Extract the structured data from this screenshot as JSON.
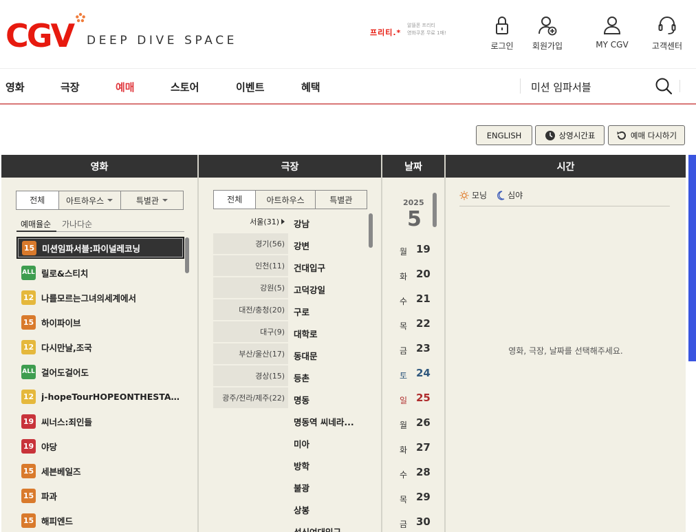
{
  "header": {
    "logo_text": "CGV",
    "tagline": "DEEP DIVE SPACE",
    "promo_brand": "프리티.*",
    "promo_line1": "알뜰폰 프리티",
    "promo_line2": "영화쿠폰 무료 1매!",
    "util": [
      {
        "label": "로그인",
        "icon": "lock-icon"
      },
      {
        "label": "회원가입",
        "icon": "user-plus-icon"
      },
      {
        "label": "MY CGV",
        "icon": "user-icon"
      },
      {
        "label": "고객센터",
        "icon": "headset-icon"
      }
    ]
  },
  "nav": {
    "items": [
      "영화",
      "극장",
      "예매",
      "스토어",
      "이벤트",
      "혜택"
    ],
    "active_index": 2,
    "search_text": "미션 임파서블"
  },
  "actions": {
    "english": "ENGLISH",
    "schedule": "상영시간표",
    "reset": "예매 다시하기"
  },
  "colors": {
    "brand_red": "#e71a0f",
    "active_nav": "#e0393e",
    "panel_bg": "#f2f0e5",
    "header_bg": "#333333",
    "rating_15": "#d97a2c",
    "rating_all": "#3e9d4f",
    "rating_12": "#e5b83c",
    "rating_19": "#c8333a"
  },
  "movie": {
    "header": "영화",
    "tabs": [
      "전체",
      "아트하우스",
      "특별관"
    ],
    "sort": [
      "예매율순",
      "가나다순"
    ],
    "list": [
      {
        "rating": "15",
        "title": "미션임파서블:파이널레코닝",
        "selected": true
      },
      {
        "rating": "ALL",
        "title": "릴로&스티치"
      },
      {
        "rating": "12",
        "title": "나를모르는그녀의세계에서"
      },
      {
        "rating": "15",
        "title": "하이파이브"
      },
      {
        "rating": "12",
        "title": "다시만날,조국"
      },
      {
        "rating": "ALL",
        "title": "걸어도걸어도"
      },
      {
        "rating": "12",
        "title": "j-hopeTourHOPEONTHESTAGEinJ..."
      },
      {
        "rating": "19",
        "title": "씨너스:죄인들"
      },
      {
        "rating": "19",
        "title": "야당"
      },
      {
        "rating": "15",
        "title": "세븐베일즈"
      },
      {
        "rating": "15",
        "title": "파과"
      },
      {
        "rating": "15",
        "title": "해피엔드"
      }
    ]
  },
  "theater": {
    "header": "극장",
    "tabs": [
      "전체",
      "아트하우스",
      "특별관"
    ],
    "regions": [
      "서울(31)",
      "경기(56)",
      "인천(11)",
      "강원(5)",
      "대전/충청(20)",
      "대구(9)",
      "부산/울산(17)",
      "경상(15)",
      "광주/전라/제주(22)"
    ],
    "list": [
      "강남",
      "강변",
      "건대입구",
      "고덕강일",
      "구로",
      "대학로",
      "동대문",
      "등촌",
      "명동",
      "명동역 씨네라...",
      "미아",
      "방학",
      "불광",
      "상봉",
      "성신여대입구"
    ]
  },
  "date": {
    "header": "날짜",
    "year": "2025",
    "month": "5",
    "days": [
      {
        "dow": "월",
        "day": "19",
        "type": "weekday"
      },
      {
        "dow": "화",
        "day": "20",
        "type": "weekday"
      },
      {
        "dow": "수",
        "day": "21",
        "type": "weekday"
      },
      {
        "dow": "목",
        "day": "22",
        "type": "weekday"
      },
      {
        "dow": "금",
        "day": "23",
        "type": "weekday"
      },
      {
        "dow": "토",
        "day": "24",
        "type": "sat"
      },
      {
        "dow": "일",
        "day": "25",
        "type": "sun"
      },
      {
        "dow": "월",
        "day": "26",
        "type": "weekday"
      },
      {
        "dow": "화",
        "day": "27",
        "type": "weekday"
      },
      {
        "dow": "수",
        "day": "28",
        "type": "weekday"
      },
      {
        "dow": "목",
        "day": "29",
        "type": "weekday"
      },
      {
        "dow": "금",
        "day": "30",
        "type": "weekday"
      }
    ]
  },
  "time": {
    "header": "시간",
    "morning": "모닝",
    "night": "심야",
    "message": "영화, 극장, 날짜를 선택해주세요."
  }
}
